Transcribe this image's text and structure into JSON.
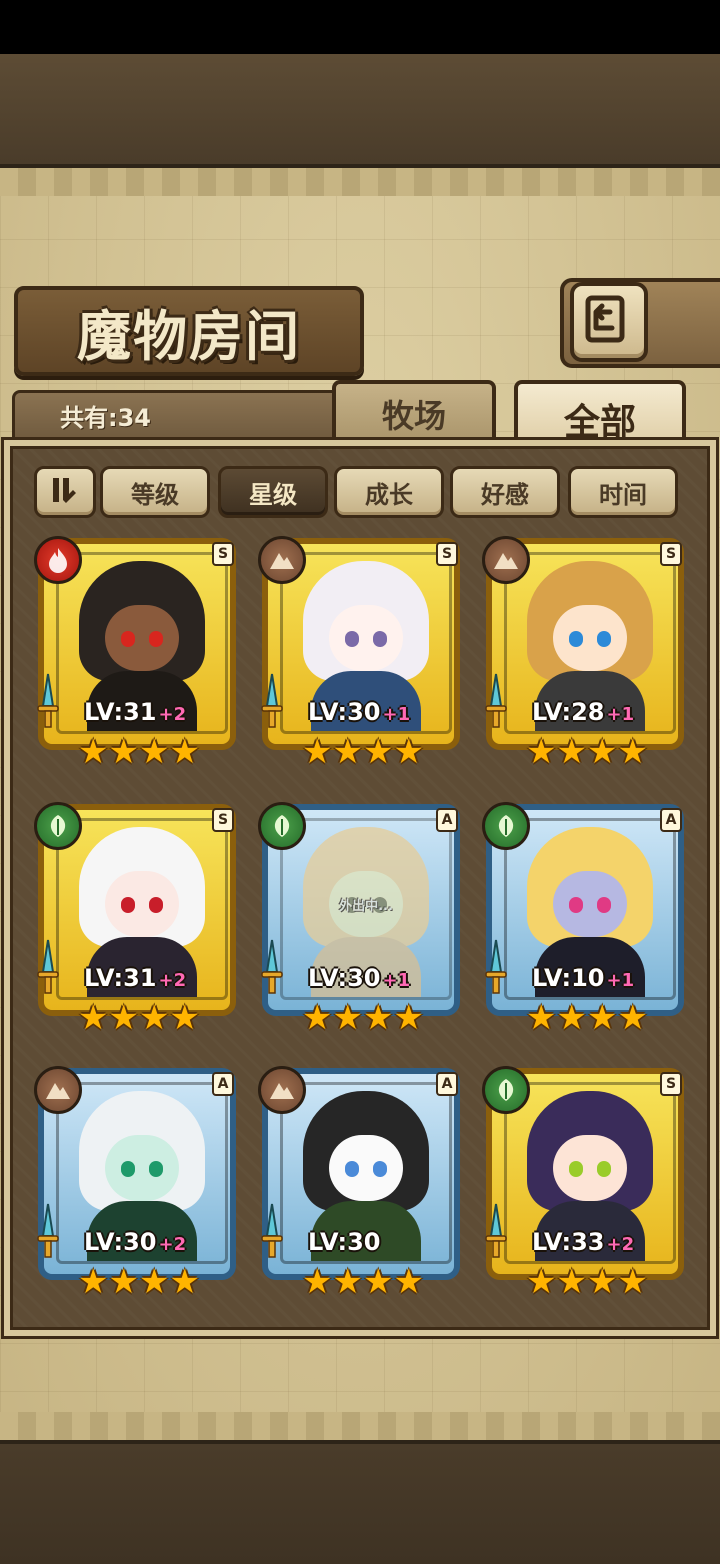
{
  "screen": {
    "title": "魔物房间",
    "count_label": "共有:34",
    "tabs": [
      {
        "label": "牧场",
        "active": false
      },
      {
        "label": "全部",
        "active": true
      }
    ],
    "sort_buttons": [
      {
        "label": "等级",
        "active": false
      },
      {
        "label": "星级",
        "active": true
      },
      {
        "label": "成长",
        "active": false
      },
      {
        "label": "好感",
        "active": false
      },
      {
        "label": "时间",
        "active": false
      }
    ],
    "icons": {
      "back": "return-arrow-icon",
      "sort_toggle": "sort-order-icon"
    }
  },
  "cards": [
    {
      "element": "fire",
      "rank": "S",
      "frame": "gold",
      "level": "LV:31",
      "bonus": "+2",
      "stars": 4,
      "away": false,
      "hair": "#2a2420",
      "skin": "#8a5a3c",
      "outfit": "#1e1a16",
      "eyes": "#d8261e"
    },
    {
      "element": "earth",
      "rank": "S",
      "frame": "gold",
      "level": "LV:30",
      "bonus": "+1",
      "stars": 4,
      "away": false,
      "hair": "#f2eef4",
      "skin": "#fff2ee",
      "outfit": "#2f4f7a",
      "eyes": "#7a6aa8"
    },
    {
      "element": "earth",
      "rank": "S",
      "frame": "gold",
      "level": "LV:28",
      "bonus": "+1",
      "stars": 4,
      "away": false,
      "hair": "#d9a24a",
      "skin": "#fde4cc",
      "outfit": "#3a3a3a",
      "eyes": "#2c8ad8"
    },
    {
      "element": "nature",
      "rank": "S",
      "frame": "gold",
      "level": "LV:31",
      "bonus": "+2",
      "stars": 4,
      "away": false,
      "hair": "#f6f6f6",
      "skin": "#fbe9e4",
      "outfit": "#2a2430",
      "eyes": "#c81e2a"
    },
    {
      "element": "nature",
      "rank": "A",
      "frame": "blue",
      "level": "LV:30",
      "bonus": "+1",
      "stars": 4,
      "away": true,
      "away_label": "外出中...",
      "hair": "#e7c883",
      "skin": "#f4dfc4",
      "outfit": "#d2b98c",
      "eyes": "#5d8a4a"
    },
    {
      "element": "nature",
      "rank": "A",
      "frame": "blue",
      "level": "LV:10",
      "bonus": "+1",
      "stars": 4,
      "away": false,
      "hair": "#f4d36a",
      "skin": "#b6b8e2",
      "outfit": "#1e1e2a",
      "eyes": "#e03a84"
    },
    {
      "element": "earth",
      "rank": "A",
      "frame": "blue",
      "level": "LV:30",
      "bonus": "+2",
      "stars": 4,
      "away": false,
      "hair": "#eef2f4",
      "skin": "#cdeee2",
      "outfit": "#1d4230",
      "eyes": "#1e9a6a"
    },
    {
      "element": "earth",
      "rank": "A",
      "frame": "blue",
      "level": "LV:30",
      "bonus": "",
      "stars": 4,
      "away": false,
      "hair": "#262626",
      "skin": "#fafafa",
      "outfit": "#2e4a26",
      "eyes": "#4a8ad8"
    },
    {
      "element": "nature",
      "rank": "S",
      "frame": "gold",
      "level": "LV:33",
      "bonus": "+2",
      "stars": 4,
      "away": false,
      "hair": "#3a2c5a",
      "skin": "#fde4d6",
      "outfit": "#2a2a3a",
      "eyes": "#9acc2a"
    }
  ]
}
